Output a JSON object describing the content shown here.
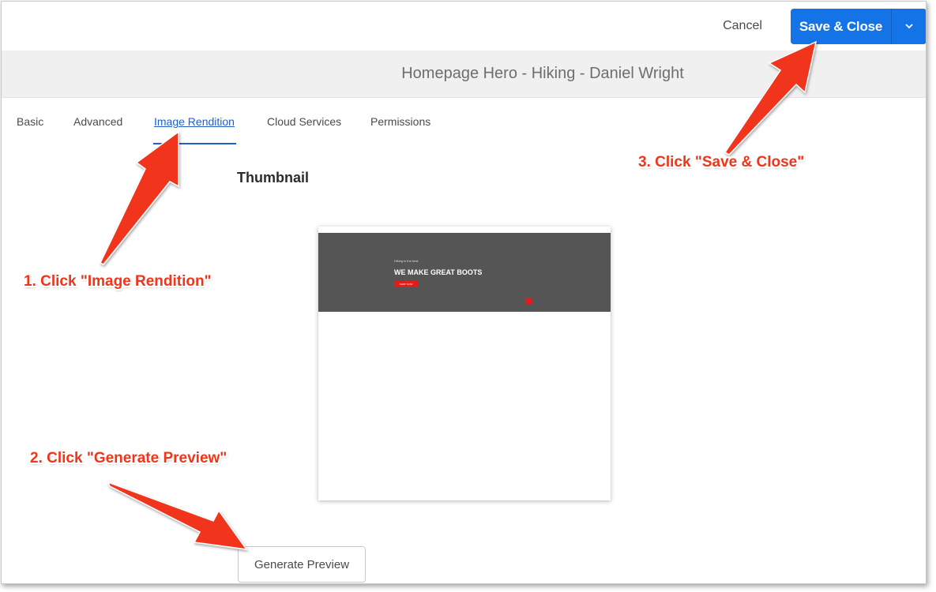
{
  "toolbar": {
    "cancel_label": "Cancel",
    "save_close_label": "Save & Close",
    "primary_color": "#1473e6"
  },
  "page": {
    "title": "Homepage Hero - Hiking - Daniel Wright"
  },
  "tabs": [
    {
      "label": "Basic",
      "active": false
    },
    {
      "label": "Advanced",
      "active": false
    },
    {
      "label": "Image Rendition",
      "active": true
    },
    {
      "label": "Cloud Services",
      "active": false
    },
    {
      "label": "Permissions",
      "active": false
    }
  ],
  "thumbnail": {
    "section_title": "Thumbnail",
    "hero_kicker": "Hiking is the best",
    "hero_headline": "WE MAKE GREAT BOOTS",
    "hero_cta": "SHOP NOW"
  },
  "actions": {
    "generate_label": "Generate Preview"
  },
  "annotations": {
    "step1": "1. Click \"Image Rendition\"",
    "step2": "2. Click \"Generate Preview\"",
    "step3": "3. Click \"Save & Close\"",
    "color": "#f0351a"
  },
  "icons": {
    "save_toggle": "chevron-down-icon"
  }
}
